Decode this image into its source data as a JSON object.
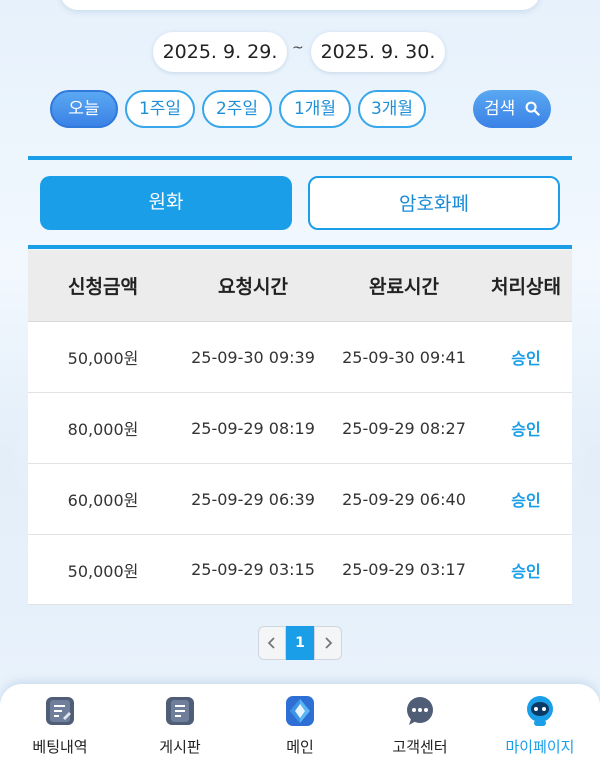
{
  "date_range": {
    "from": "2025. 9. 29.",
    "separator": "~",
    "to": "2025. 9. 30."
  },
  "periods": [
    "오늘",
    "1주일",
    "2주일",
    "1개월",
    "3개월"
  ],
  "active_period": "오늘",
  "search_label": "검색",
  "tabs": {
    "active": "원화",
    "inactive": "암호화폐"
  },
  "table": {
    "headers": [
      "신청금액",
      "요청시간",
      "완료시간",
      "처리상태"
    ],
    "rows": [
      [
        "50,000원",
        "25-09-30 09:39",
        "25-09-30 09:41",
        "승인"
      ],
      [
        "80,000원",
        "25-09-29 08:19",
        "25-09-29 08:27",
        "승인"
      ],
      [
        "60,000원",
        "25-09-29 06:39",
        "25-09-29 06:40",
        "승인"
      ],
      [
        "50,000원",
        "25-09-29 03:15",
        "25-09-29 03:17",
        "승인"
      ]
    ]
  },
  "pagination": {
    "current": "1"
  },
  "bottom_nav": [
    {
      "label": "베팅내역",
      "icon": "betting-history-icon"
    },
    {
      "label": "게시판",
      "icon": "board-icon"
    },
    {
      "label": "메인",
      "icon": "main-diamond-icon"
    },
    {
      "label": "고객센터",
      "icon": "chat-bubble-icon"
    },
    {
      "label": "마이페이지",
      "icon": "mypage-robot-icon"
    }
  ],
  "colors": {
    "accent": "#1a9ee8",
    "active_button": "#3b82e6"
  }
}
